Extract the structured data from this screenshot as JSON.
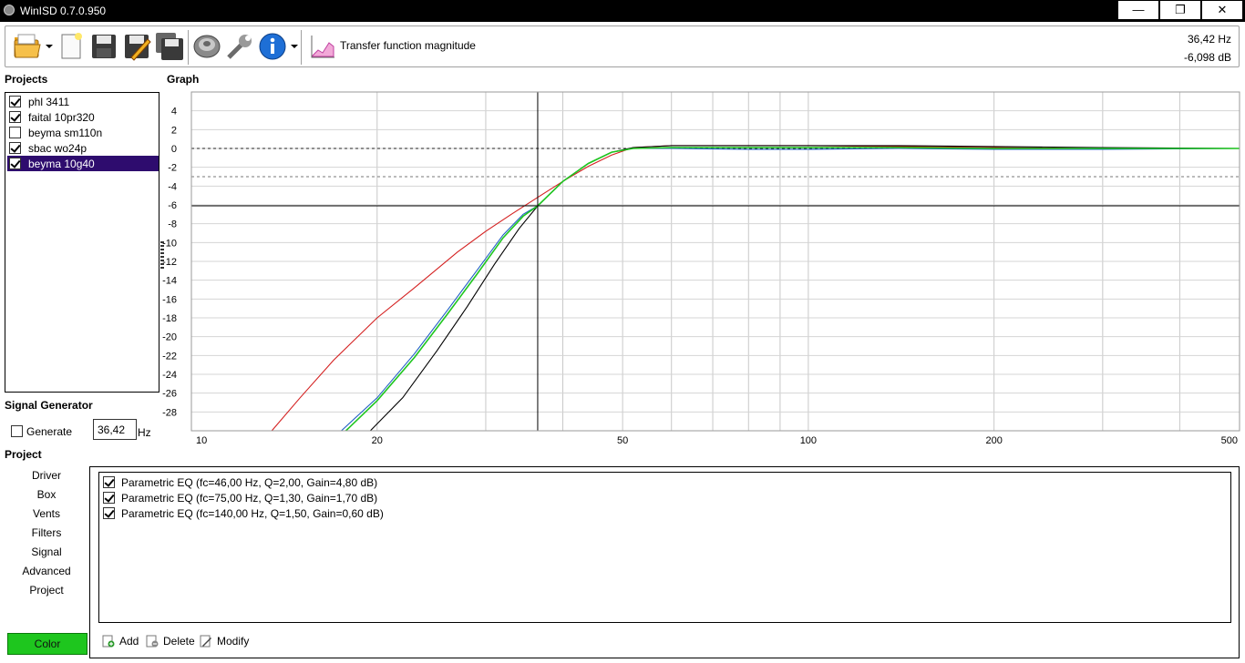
{
  "window": {
    "title": "WinISD 0.7.0.950",
    "min_glyph": "—",
    "max_glyph": "❐",
    "close_glyph": "✕"
  },
  "toolbar": {
    "icons": [
      "open-folder-icon",
      "new-document-icon",
      "save-icon",
      "save-as-edit-icon",
      "save-all-icon",
      "driver-speaker-icon",
      "tools-wrench-icon",
      "info-icon",
      "graph-type-icon"
    ],
    "graph_type_label": "Transfer function magnitude",
    "readout_freq": "36,42 Hz",
    "readout_db": "-6,098 dB"
  },
  "projects": {
    "title": "Projects",
    "items": [
      {
        "label": "phl 3411",
        "checked": true,
        "selected": false
      },
      {
        "label": "faital 10pr320",
        "checked": true,
        "selected": false
      },
      {
        "label": "beyma sm110n",
        "checked": false,
        "selected": false
      },
      {
        "label": "sbac wo24p",
        "checked": true,
        "selected": false
      },
      {
        "label": "beyma 10g40",
        "checked": true,
        "selected": true
      }
    ]
  },
  "signal_generator": {
    "title": "Signal Generator",
    "generate_label": "Generate",
    "generate_checked": false,
    "frequency_value": "36,42",
    "unit": "Hz"
  },
  "project_nav": {
    "title": "Project",
    "items": [
      "Driver",
      "Box",
      "Vents",
      "Filters",
      "Signal",
      "Advanced",
      "Project"
    ],
    "color_button": "Color",
    "color": "#1ec61e"
  },
  "graph": {
    "title": "Graph"
  },
  "filters": {
    "items": [
      {
        "label": "Parametric EQ (fc=46,00 Hz, Q=2,00, Gain=4,80 dB)",
        "checked": true
      },
      {
        "label": "Parametric EQ (fc=75,00 Hz, Q=1,30, Gain=1,70 dB)",
        "checked": true
      },
      {
        "label": "Parametric EQ (fc=140,00 Hz, Q=1,50, Gain=0,60 dB)",
        "checked": true
      }
    ],
    "add_label": "Add",
    "delete_label": "Delete",
    "modify_label": "Modify"
  },
  "chart_data": {
    "type": "line",
    "title": "",
    "xlabel": "",
    "ylabel": "",
    "x_scale": "log",
    "xlim": [
      10,
      500
    ],
    "ylim": [
      -30,
      6
    ],
    "x_tick_labels": [
      {
        "x": 10,
        "label": "10"
      },
      {
        "x": 20,
        "label": "20"
      },
      {
        "x": 50,
        "label": "50"
      },
      {
        "x": 100,
        "label": "100"
      },
      {
        "x": 200,
        "label": "200"
      },
      {
        "x": 500,
        "label": "500"
      }
    ],
    "y_ticks": [
      4,
      2,
      0,
      -2,
      -4,
      -6,
      -8,
      -10,
      -12,
      -14,
      -16,
      -18,
      -20,
      -22,
      -24,
      -26,
      -28
    ],
    "grid": true,
    "reference_lines": {
      "zero_db": 0,
      "minus_3db": -3
    },
    "cursor": {
      "x": 36.42,
      "y": -6.098
    },
    "series": [
      {
        "color": "#d42020",
        "x": [
          13.5,
          15,
          17,
          20,
          23,
          27,
          30,
          33,
          36.42,
          40,
          44,
          48,
          52,
          60,
          80,
          100,
          140,
          200,
          300,
          500
        ],
        "y": [
          -30,
          -26.5,
          -22.5,
          -18,
          -14.8,
          -11,
          -8.8,
          -7,
          -5.2,
          -3.5,
          -1.9,
          -0.7,
          0.1,
          0.3,
          0.3,
          0.3,
          0.2,
          0.1,
          0,
          0
        ]
      },
      {
        "color": "#000000",
        "x": [
          19.5,
          22,
          25,
          28,
          31,
          34,
          36.42,
          40,
          44,
          48,
          52,
          60,
          80,
          100,
          140,
          200,
          300,
          500
        ],
        "y": [
          -30,
          -26.5,
          -21.5,
          -16.8,
          -12.3,
          -8.5,
          -6.1,
          -3.5,
          -1.6,
          -0.4,
          0.1,
          0.3,
          0.3,
          0.3,
          0.3,
          0.2,
          0.1,
          0
        ]
      },
      {
        "color": "#1f5fc4",
        "x": [
          17.5,
          20,
          23,
          26,
          29,
          32,
          34.5,
          36.42,
          40,
          44,
          48,
          52,
          60,
          80,
          100,
          140,
          200,
          300,
          500
        ],
        "y": [
          -30,
          -26.5,
          -21.8,
          -17.2,
          -13,
          -9.2,
          -7,
          -6.1,
          -3.5,
          -1.6,
          -0.4,
          0,
          0,
          -0.1,
          -0.1,
          0,
          -0.1,
          -0.1,
          0
        ]
      },
      {
        "color": "#1ec61e",
        "x": [
          17.8,
          20,
          23,
          26,
          29,
          32,
          34.5,
          36.42,
          40,
          44,
          48,
          52,
          60,
          80,
          100,
          140,
          200,
          300,
          500
        ],
        "y": [
          -30,
          -26.8,
          -22.2,
          -17.6,
          -13.4,
          -9.5,
          -7.2,
          -6.1,
          -3.5,
          -1.6,
          -0.4,
          0,
          0.1,
          0.1,
          0.1,
          0.1,
          0,
          0,
          0
        ]
      }
    ]
  }
}
